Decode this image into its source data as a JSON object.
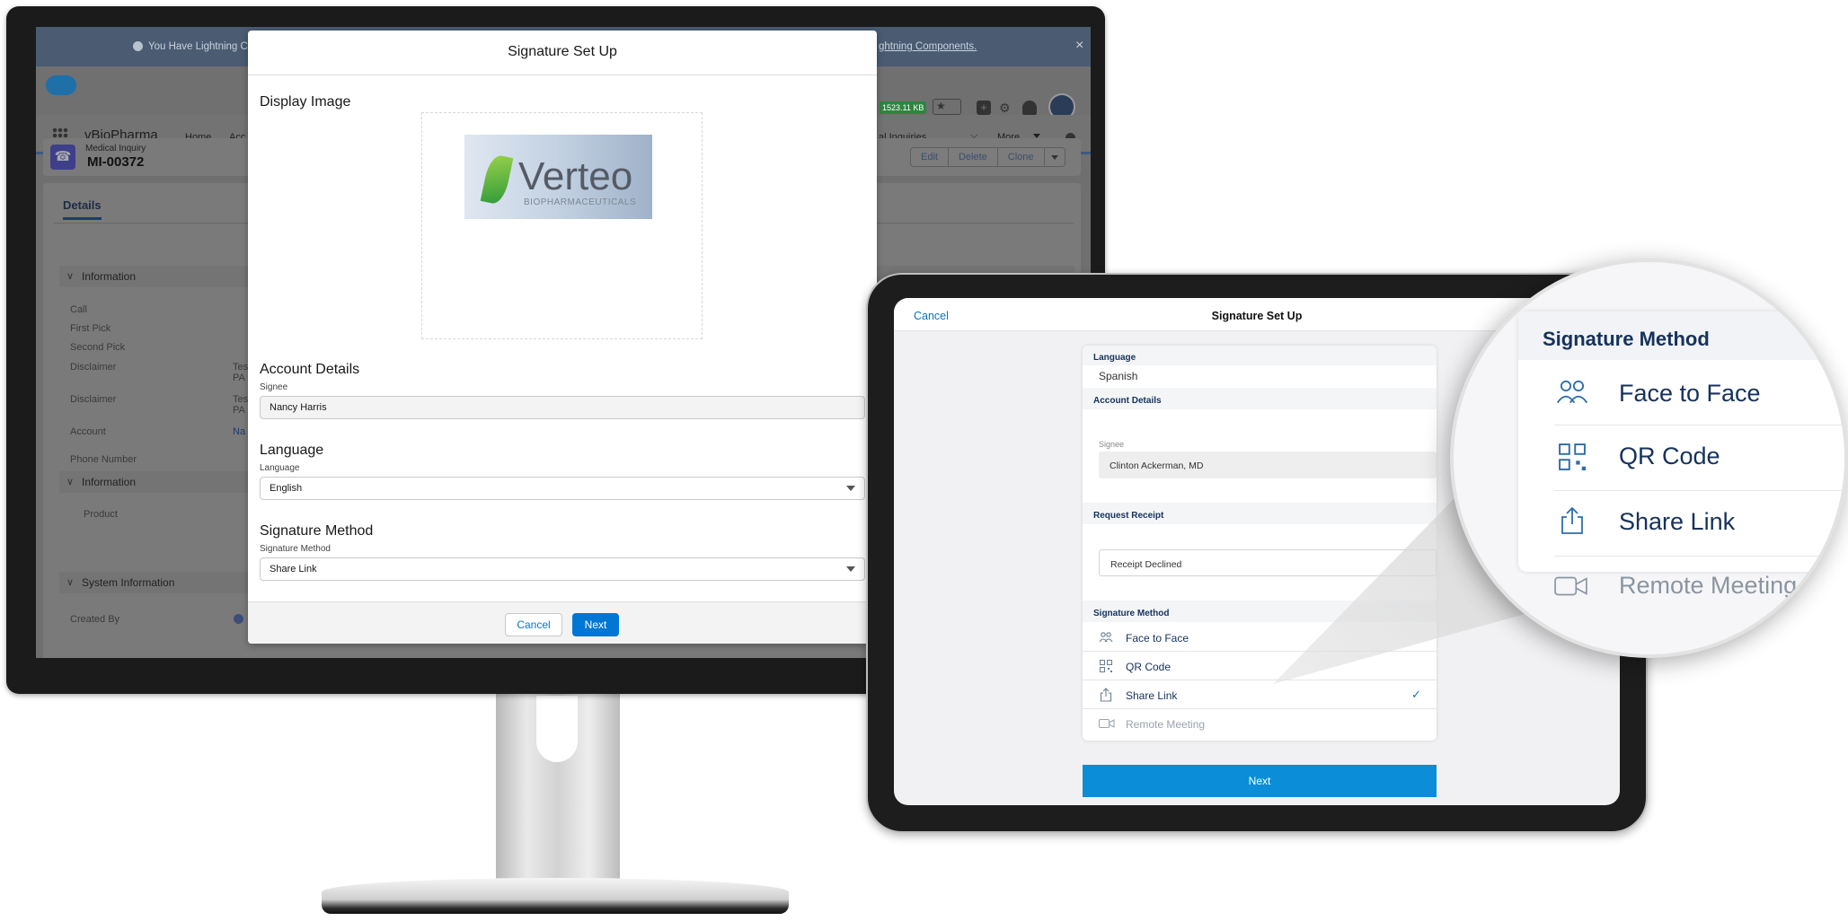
{
  "desktop": {
    "banner": {
      "text": "You Have Lightning Co",
      "link_text": "ghtning Components.",
      "close": "×"
    },
    "header": {
      "storage_badge": "1523.11 KB"
    },
    "nav": {
      "app_name": "vBioPharma",
      "home": "Home",
      "acc": "Acc",
      "inquiries": "al Inquiries",
      "more": "More"
    },
    "record": {
      "type": "Medical Inquiry",
      "id": "MI-00372",
      "actions": [
        "Edit",
        "Delete",
        "Clone"
      ]
    },
    "tabs": {
      "details": "Details"
    },
    "sections": {
      "information": "Information",
      "information_2": "Information",
      "system_information": "System Information"
    },
    "fields": {
      "call": "Call",
      "first_pick": "First Pick",
      "second_pick": "Second Pick",
      "disclaimer_1": "Disclaimer",
      "disclaimer_1_value": "Tes",
      "disclaimer_1_value_2": "PA",
      "disclaimer_2": "Disclaimer",
      "disclaimer_2_value": "Tes",
      "disclaimer_2_value_2": "PA",
      "account": "Account",
      "account_value": "Na",
      "phone_number": "Phone Number",
      "product": "Product",
      "created_by": "Created By"
    },
    "modal": {
      "title": "Signature Set Up",
      "display_image_heading": "Display Image",
      "logo_main": "Verteo",
      "logo_sub": "BIOPHARMACEUTICALS",
      "account_details_heading": "Account Details",
      "signee_label": "Signee",
      "signee_value": "Nancy Harris",
      "language_heading": "Language",
      "language_label": "Language",
      "language_value": "English",
      "signature_method_heading": "Signature Method",
      "signature_method_label": "Signature Method",
      "signature_method_value": "Share Link",
      "cancel": "Cancel",
      "next": "Next"
    }
  },
  "tablet": {
    "cancel": "Cancel",
    "title": "Signature Set Up",
    "language_label": "Language",
    "language_value": "Spanish",
    "account_details": "Account Details",
    "signee_label": "Signee",
    "signee_value": "Clinton Ackerman, MD",
    "request_receipt": "Request Receipt",
    "receipt_value": "Receipt Declined",
    "signature_method": "Signature Method",
    "methods": [
      {
        "label": "Face to Face",
        "icon": "people-icon"
      },
      {
        "label": "QR Code",
        "icon": "qr-code-icon"
      },
      {
        "label": "Share Link",
        "icon": "share-icon",
        "selected": true
      },
      {
        "label": "Remote Meeting",
        "icon": "video-icon",
        "disabled": true
      }
    ],
    "checkmark": "✓",
    "next": "Next"
  },
  "zoom": {
    "heading": "Signature Method",
    "methods": [
      {
        "label": "Face to Face",
        "icon": "people-icon"
      },
      {
        "label": "QR Code",
        "icon": "qr-code-icon"
      },
      {
        "label": "Share Link",
        "icon": "share-icon"
      },
      {
        "label": "Remote Meeting",
        "icon": "video-icon",
        "disabled": true
      }
    ]
  },
  "colors": {
    "salesforce_blue": "#0176d3",
    "heading_navy": "#16325c",
    "tablet_next": "#0b8dd8",
    "storage_badge": "#2e8540"
  }
}
